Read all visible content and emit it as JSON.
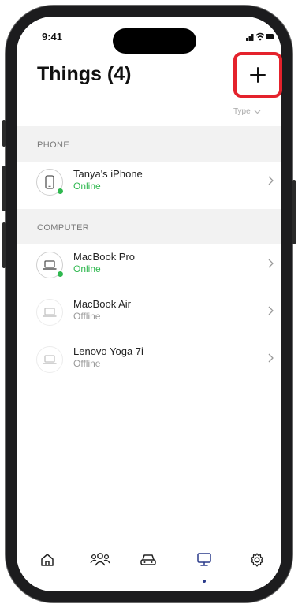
{
  "status_bar": {
    "time": "9:41"
  },
  "header": {
    "title": "Things (4)",
    "add_icon": "plus-icon"
  },
  "sort": {
    "label": "Type"
  },
  "sections": [
    {
      "label": "PHONE",
      "items": [
        {
          "name": "Tanya's iPhone",
          "status": "Online",
          "icon": "phone-icon"
        }
      ]
    },
    {
      "label": "COMPUTER",
      "items": [
        {
          "name": "MacBook Pro",
          "status": "Online",
          "icon": "laptop-icon"
        },
        {
          "name": "MacBook Air",
          "status": "Offline",
          "icon": "laptop-icon"
        },
        {
          "name": "Lenovo Yoga 7i",
          "status": "Offline",
          "icon": "laptop-icon"
        }
      ]
    }
  ],
  "tabbar": {
    "tabs": [
      {
        "icon": "home-icon"
      },
      {
        "icon": "people-icon"
      },
      {
        "icon": "car-icon"
      },
      {
        "icon": "devices-icon",
        "active": true
      },
      {
        "icon": "settings-icon"
      }
    ]
  },
  "colors": {
    "online": "#2fb84f",
    "highlight": "#e4222c",
    "active_tab": "#2a3a8a"
  }
}
